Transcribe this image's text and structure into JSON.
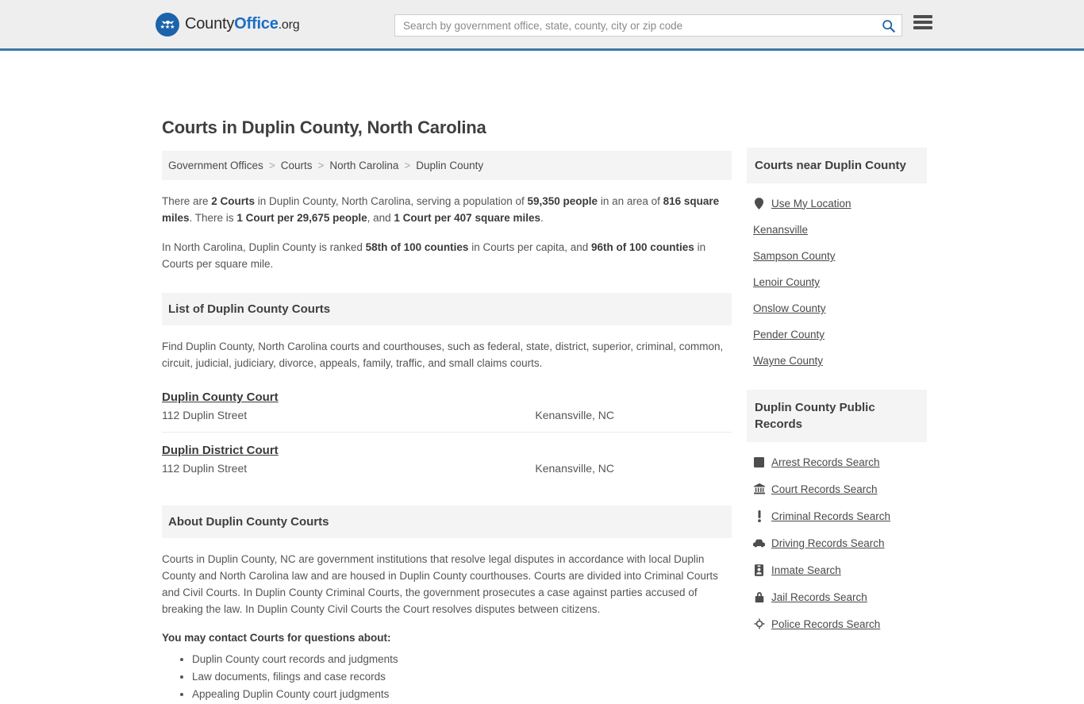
{
  "header": {
    "logo": {
      "part1": "County",
      "part2": "Office",
      "part3": ".org",
      "icon": "eagle-seal-icon"
    },
    "search": {
      "placeholder": "Search by government office, state, county, city or zip code",
      "value": "",
      "icon": "search-icon"
    },
    "menu_icon": "hamburger-menu-icon"
  },
  "page": {
    "title": "Courts in Duplin County, North Carolina"
  },
  "breadcrumb": {
    "items": [
      {
        "label": "Government Offices"
      },
      {
        "label": "Courts"
      },
      {
        "label": "North Carolina"
      },
      {
        "label": "Duplin County"
      }
    ],
    "separator": ">"
  },
  "stats": {
    "p1_a": "There are ",
    "p1_courts": "2 Courts",
    "p1_b": " in Duplin County, North Carolina, serving a population of ",
    "p1_population": "59,350 people",
    "p1_c": " in an area of ",
    "p1_area": "816 square miles",
    "p1_d": ". There is ",
    "p1_percapita": "1 Court per 29,675 people",
    "p1_e": ", and ",
    "p1_persqmi": "1 Court per 407 square miles",
    "p1_f": ".",
    "p2_a": "In North Carolina, Duplin County is ranked ",
    "p2_rank1": "58th of 100 counties",
    "p2_b": " in Courts per capita, and ",
    "p2_rank2": "96th of 100 counties",
    "p2_c": " in Courts per square mile."
  },
  "list_section": {
    "heading": "List of Duplin County Courts",
    "description": "Find Duplin County, North Carolina courts and courthouses, such as federal, state, district, superior, criminal, common, circuit, judicial, judiciary, divorce, appeals, family, traffic, and small claims courts.",
    "courts": [
      {
        "name": "Duplin County Court",
        "address": "112 Duplin Street",
        "city": "Kenansville, NC"
      },
      {
        "name": "Duplin District Court",
        "address": "112 Duplin Street",
        "city": "Kenansville, NC"
      }
    ]
  },
  "about_section": {
    "heading": "About Duplin County Courts",
    "body": "Courts in Duplin County, NC are government institutions that resolve legal disputes in accordance with local Duplin County and North Carolina law and are housed in Duplin County courthouses. Courts are divided into Criminal Courts and Civil Courts. In Duplin County Criminal Courts, the government prosecutes a case against parties accused of breaking the law. In Duplin County Civil Courts the Court resolves disputes between citizens.",
    "contact_lead": "You may contact Courts for questions about:",
    "bullets": [
      "Duplin County court records and judgments",
      "Law documents, filings and case records",
      "Appealing Duplin County court judgments"
    ]
  },
  "sidebar": {
    "nearby": {
      "heading": "Courts near Duplin County",
      "items": [
        {
          "label": "Use My Location",
          "icon": "map-pin-icon"
        },
        {
          "label": "Kenansville",
          "icon": ""
        },
        {
          "label": "Sampson County",
          "icon": ""
        },
        {
          "label": "Lenoir County",
          "icon": ""
        },
        {
          "label": "Onslow County",
          "icon": ""
        },
        {
          "label": "Pender County",
          "icon": ""
        },
        {
          "label": "Wayne County",
          "icon": ""
        }
      ]
    },
    "public_records": {
      "heading": "Duplin County Public Records",
      "items": [
        {
          "label": "Arrest Records Search",
          "icon": "fingerprint-icon"
        },
        {
          "label": "Court Records Search",
          "icon": "courthouse-icon"
        },
        {
          "label": "Criminal Records Search",
          "icon": "exclamation-icon"
        },
        {
          "label": "Driving Records Search",
          "icon": "car-icon"
        },
        {
          "label": "Inmate Search",
          "icon": "id-badge-icon"
        },
        {
          "label": "Jail Records Search",
          "icon": "padlock-icon"
        },
        {
          "label": "Police Records Search",
          "icon": "police-badge-icon"
        }
      ]
    }
  },
  "colors": {
    "accent_blue": "#1b6fc4",
    "rule_blue": "#3b77a8",
    "band_gray": "#f4f4f4",
    "text_gray": "#4a4a4a"
  }
}
